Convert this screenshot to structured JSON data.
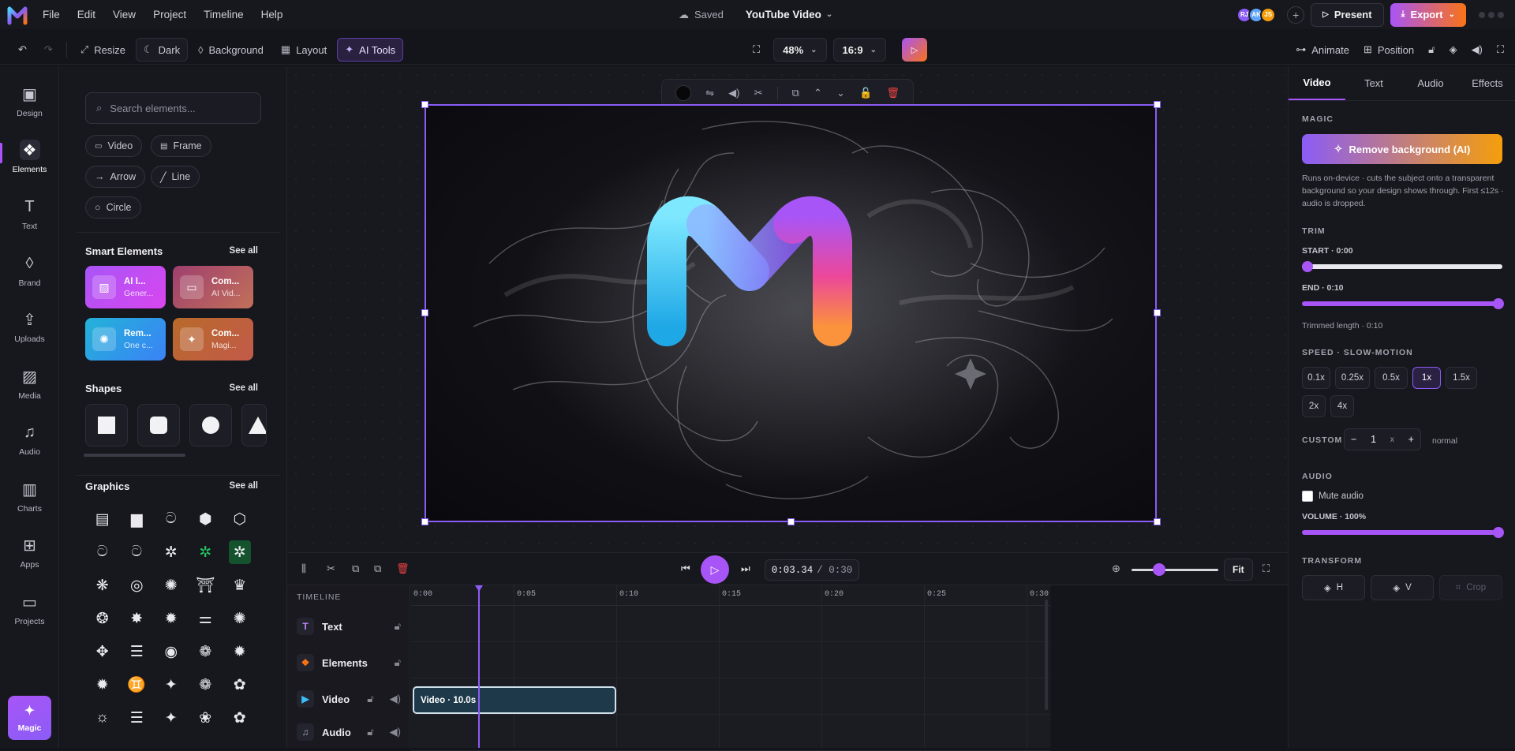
{
  "menu": [
    "File",
    "Edit",
    "View",
    "Project",
    "Timeline",
    "Help"
  ],
  "header": {
    "saved_label": "Saved",
    "doc_title": "YouTube Video",
    "present_label": "Present",
    "export_label": "Export"
  },
  "collaborators": [
    {
      "initials": "RJ",
      "color": "#8b5cf6"
    },
    {
      "initials": "AK",
      "color": "#60a5fa"
    },
    {
      "initials": "JS",
      "color": "#f59e0b"
    }
  ],
  "toolbar": {
    "resize": "Resize",
    "theme": "Dark",
    "background": "Background",
    "layout": "Layout",
    "ai_tools": "AI Tools",
    "zoom": "48%",
    "aspect": "16:9",
    "animate": "Animate",
    "position": "Position"
  },
  "leftnav": [
    "Design",
    "Elements",
    "Text",
    "Brand",
    "Uploads",
    "Media",
    "Audio",
    "Charts",
    "Apps",
    "Projects"
  ],
  "magic_label": "Magic",
  "elements_panel": {
    "search_placeholder": "Search elements...",
    "chips": [
      "Video",
      "Frame",
      "Arrow",
      "Line",
      "Circle"
    ],
    "smart_title": "Smart Elements",
    "shapes_title": "Shapes",
    "graphics_title": "Graphics",
    "see_all": "See all",
    "smart_cards": [
      {
        "title": "AI I...",
        "sub": "Gener...",
        "icon": "image-icon",
        "gradient": "linear-gradient(135deg,#a855f7,#d946ef)"
      },
      {
        "title": "Com...",
        "sub": "AI Vid...",
        "icon": "video-icon",
        "gradient": "linear-gradient(135deg,#9f3f6e,#c2705a)"
      },
      {
        "title": "Rem...",
        "sub": "One c...",
        "icon": "sparkle-icon",
        "gradient": "linear-gradient(135deg,#22b3d8,#3b82f6)"
      },
      {
        "title": "Com...",
        "sub": "Magi...",
        "icon": "wand-icon",
        "gradient": "linear-gradient(135deg,#b86a2a,#c25a4a)"
      }
    ],
    "graphics": [
      "▤",
      "▆",
      "ට",
      "⬢",
      "⬡",
      "ට",
      "ට",
      "✲",
      "✲",
      "✲",
      "❋",
      "◎",
      "✺",
      "⛩",
      "♛",
      "❂",
      "✸",
      "✹",
      "⚌",
      "✺",
      "✥",
      "☰",
      "◉",
      "❁",
      "✹",
      "✹",
      "♊",
      "✦",
      "❁",
      "✿",
      "☼",
      "☰",
      "✦",
      "❀",
      "✿"
    ]
  },
  "floating_toolbar": [
    "⇋",
    "◀)",
    "✂",
    "⧉",
    "⌃",
    "⌄",
    "🔓",
    "🗑"
  ],
  "timeline": {
    "current": "0:03.34",
    "duration": "/ 0:30",
    "fit": "Fit",
    "heading": "TIMELINE",
    "ticks": [
      "0:00",
      "0:05",
      "0:10",
      "0:15",
      "0:20",
      "0:25",
      "0:30"
    ],
    "tracks": [
      {
        "name": "Text",
        "icon": "T",
        "color": "#c084fc"
      },
      {
        "name": "Elements",
        "icon": "❖",
        "color": "#f97316"
      },
      {
        "name": "Video",
        "icon": "▶",
        "color": "#38bdf8"
      },
      {
        "name": "Audio",
        "icon": "♫",
        "color": "#a3a3ae"
      }
    ],
    "clip_label": "Video · 10.0s"
  },
  "right_panel": {
    "tabs": [
      "Video",
      "Text",
      "Audio",
      "Effects"
    ],
    "magic_title": "MAGIC",
    "remove_bg": "Remove background (AI)",
    "magic_note": "Runs on-device · cuts the subject onto a transparent background so your design shows through. First ≤12s · audio is dropped.",
    "trim_title": "TRIM",
    "start_label": "START · 0:00",
    "end_label": "END · 0:10",
    "trimmed_note": "Trimmed length · 0:10",
    "speed_title": "SPEED · SLOW-MOTION",
    "speeds": [
      "0.1x",
      "0.25x",
      "0.5x",
      "1x",
      "1.5x",
      "2x",
      "4x"
    ],
    "selected_speed": "1x",
    "custom_label": "CUSTOM",
    "custom_value": "1",
    "custom_unit": "x",
    "custom_note": "normal",
    "audio_title": "AUDIO",
    "mute_label": "Mute audio",
    "volume_label": "VOLUME · 100%",
    "transform_title": "TRANSFORM",
    "flip_h": "H",
    "flip_v": "V",
    "crop": "Crop"
  }
}
